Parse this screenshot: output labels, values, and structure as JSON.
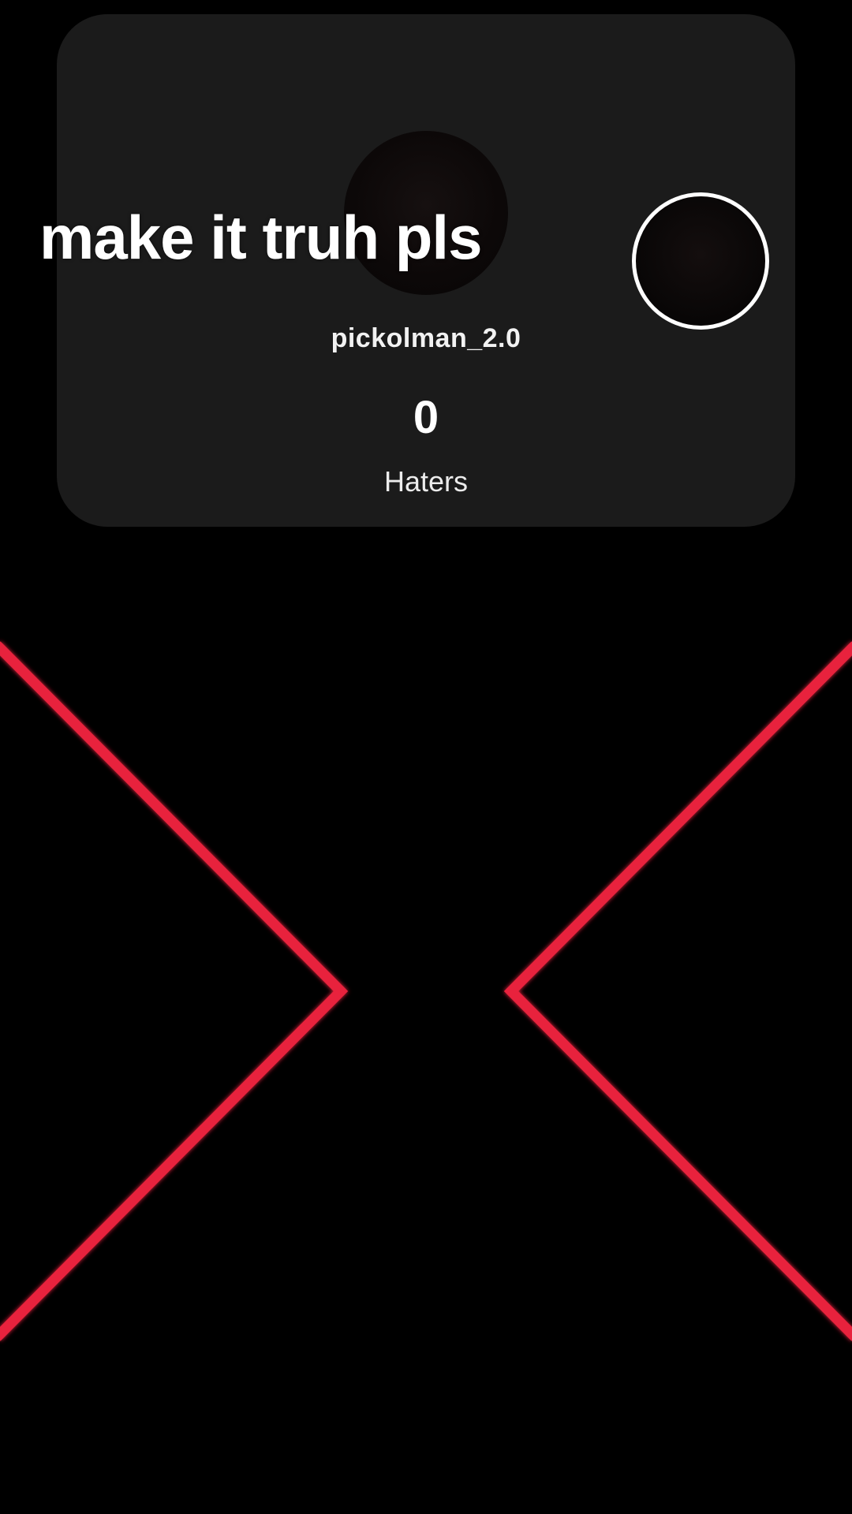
{
  "caption": {
    "text": "make it truh pls"
  },
  "profile": {
    "username": "pickolman_2.0",
    "count": "0",
    "count_label": "Haters"
  },
  "colors": {
    "background": "#000000",
    "card": "#1b1b1b",
    "accent_red": "#e8213c",
    "text": "#ffffff"
  },
  "icons": {
    "x_graphic": "red-x-chevrons-icon",
    "avatar_ring": "profile-ring-avatar"
  }
}
